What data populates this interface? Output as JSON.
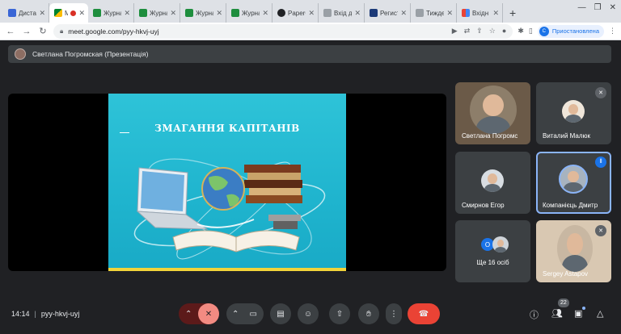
{
  "browser": {
    "tabs": [
      {
        "label": "Дистан",
        "favicon": "blue-doc-icon",
        "active": false
      },
      {
        "label": "Me",
        "favicon": "meet-icon",
        "active": true,
        "recording": true
      },
      {
        "label": "Журна",
        "favicon": "green-sheet-icon",
        "active": false
      },
      {
        "label": "Журна",
        "favicon": "green-sheet-icon",
        "active": false
      },
      {
        "label": "Журна",
        "favicon": "green-sheet-icon",
        "active": false
      },
      {
        "label": "Журна",
        "favicon": "green-sheet-icon",
        "active": false
      },
      {
        "label": "PaperG",
        "favicon": "black-circle-icon",
        "active": false
      },
      {
        "label": "Вхід до",
        "favicon": "grey-page-icon",
        "active": false
      },
      {
        "label": "Регист",
        "favicon": "navy-t-icon",
        "active": false
      },
      {
        "label": "Тиждe",
        "favicon": "grey-page-icon",
        "active": false
      },
      {
        "label": "Вхідн",
        "favicon": "gmail-icon",
        "active": false
      }
    ],
    "new_tab": "+",
    "url": "meet.google.com/pyy-hkvj-uyj",
    "profile_label": "Приостановлена",
    "profile_initial": "С"
  },
  "presentation_bar": {
    "label": "Светлана Погромская (Презентація)"
  },
  "slide": {
    "title": "ЗМАГАННЯ КАПІТАНІВ"
  },
  "participants": [
    {
      "name": "Светлана Погромс",
      "muted": false,
      "speaking": false
    },
    {
      "name": "Виталий Малюк",
      "muted": true,
      "speaking": false
    },
    {
      "name": "Смирнов Егор",
      "muted": false,
      "speaking": false
    },
    {
      "name": "Компанієць Дмитр",
      "muted": false,
      "speaking": true
    },
    {
      "name": "Sergey Astapov",
      "muted": true,
      "speaking": false
    }
  ],
  "more_participants": {
    "label": "Ще 16 осіб",
    "initial": "О"
  },
  "bottom": {
    "time": "14:14",
    "separator": "|",
    "meeting_code": "pyy-hkvj-uyj",
    "people_count": "22"
  },
  "colors": {
    "meet_bg": "#202124",
    "tile_bg": "#3c4043",
    "end_call": "#ea4335",
    "accent_blue": "#1a73e8",
    "slide_bg": "#2ec3d8"
  }
}
